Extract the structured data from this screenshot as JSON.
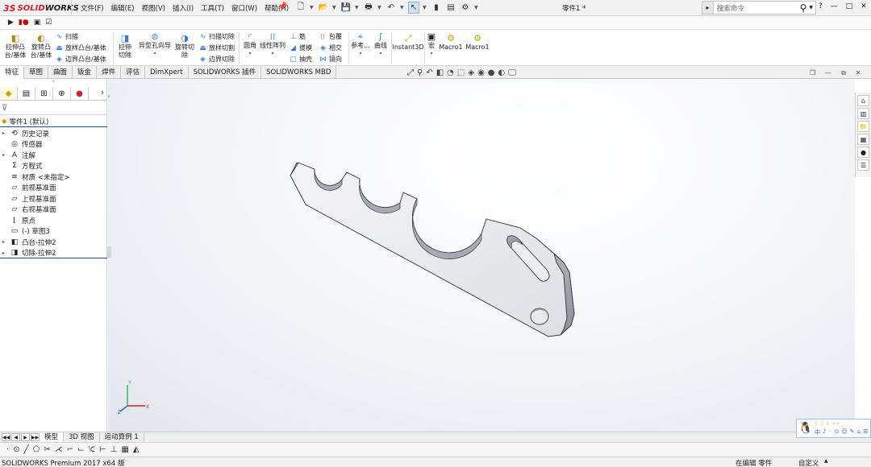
{
  "app": {
    "brand_ds": "3S",
    "brand_name_red": "SOLID",
    "brand_name_dark": "WORKS",
    "document_title": "零件1 *"
  },
  "menu": [
    "文件(F)",
    "编辑(E)",
    "视图(V)",
    "插入(I)",
    "工具(T)",
    "窗口(W)",
    "帮助(H)"
  ],
  "search": {
    "placeholder": "搜索命令"
  },
  "window_buttons": [
    "?",
    "—",
    "□",
    "✕"
  ],
  "ribbon": {
    "extrude_boss": "拉伸凸台/基体",
    "revolve_boss": "旋转凸台/基体",
    "sweep": "扫描",
    "loft_boss": "放样凸台/基体",
    "boundary_boss": "边界凸台/基体",
    "extrude_cut": "拉伸切除",
    "hole_wizard": "异型孔向导",
    "revolve_cut": "旋转切除",
    "swept_cut": "扫描切除",
    "lofted_cut": "放样切割",
    "boundary_cut": "边界切除",
    "fillet": "圆角",
    "linear_pattern": "线性阵列",
    "rib": "筋",
    "draft": "拔模",
    "shell": "抽壳",
    "wrap": "包覆",
    "intersect": "相交",
    "mirror": "镜向",
    "reference": "参考...",
    "curves": "曲线",
    "instant3d": "Instant3D",
    "macro": "宏",
    "macro1a": "Macro1",
    "macro1b": "Macro1"
  },
  "tabs": [
    "特征",
    "草图",
    "曲面",
    "钣金",
    "焊件",
    "评估",
    "DimXpert",
    "SOLIDWORKS 插件",
    "SOLIDWORKS MBD"
  ],
  "active_tab": "特征",
  "tree": {
    "root": "零件1  (默认)",
    "items": [
      {
        "label": "历史记录",
        "icon": "history-icon",
        "expand": true
      },
      {
        "label": "传感器",
        "icon": "sensor-icon",
        "expand": false
      },
      {
        "label": "注解",
        "icon": "annotations-icon",
        "expand": true
      },
      {
        "label": "方程式",
        "icon": "equations-icon",
        "expand": false
      },
      {
        "label": "材质 <未指定>",
        "icon": "material-icon",
        "expand": false
      },
      {
        "label": "前视基准面",
        "icon": "plane-icon",
        "expand": false
      },
      {
        "label": "上视基准面",
        "icon": "plane-icon",
        "expand": false
      },
      {
        "label": "右视基准面",
        "icon": "plane-icon",
        "expand": false
      },
      {
        "label": "原点",
        "icon": "origin-icon",
        "expand": false
      },
      {
        "label": "(-) 草图3",
        "icon": "sketch-icon",
        "expand": false
      },
      {
        "label": "凸台-拉伸2",
        "icon": "boss-extrude-icon",
        "expand": true
      },
      {
        "label": "切除-拉伸2",
        "icon": "cut-extrude-icon",
        "expand": true
      }
    ]
  },
  "bottom_tabs": [
    "模型",
    "3D 视图",
    "运动算例 1"
  ],
  "active_bottom_tab": "模型",
  "status": {
    "left": "SOLIDWORKS Premium 2017 x64 版",
    "mode": "在编辑 零件",
    "custom": "自定义"
  },
  "triad": {
    "x": "X",
    "y": "Y",
    "z": "Z"
  },
  "qq": {
    "row": [
      "中",
      "♪",
      "◦",
      "⊙",
      "☺",
      "✎",
      "⌂",
      "☰"
    ]
  },
  "colors": {
    "brand_red": "#d2232a",
    "selection_blue": "#1c4fa0",
    "part_grey": "#dcdde2"
  }
}
